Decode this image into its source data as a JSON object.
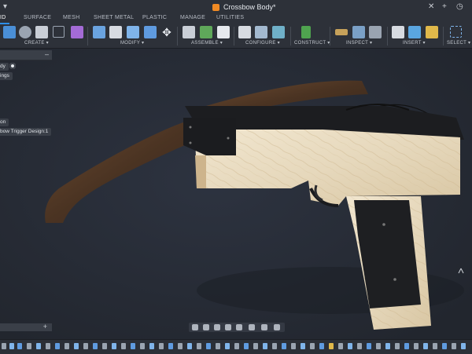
{
  "window": {
    "title": "Crossbow Body*",
    "menu_caret": "▾",
    "ctl_close": "✕",
    "ctl_plus": "+",
    "ctl_clock": "◷"
  },
  "tabs": [
    {
      "label": "ID",
      "active": true
    },
    {
      "label": "SURFACE",
      "active": false
    },
    {
      "label": "MESH",
      "active": false
    },
    {
      "label": "SHEET METAL",
      "active": false
    },
    {
      "label": "PLASTIC",
      "active": false
    },
    {
      "label": "MANAGE",
      "active": false
    },
    {
      "label": "UTILITIES",
      "active": false
    }
  ],
  "ribbon": {
    "groups": [
      {
        "label": "CREATE ▾"
      },
      {
        "label": "MODIFY ▾"
      },
      {
        "label": "ASSEMBLE ▾"
      },
      {
        "label": "CONFIGURE ▾"
      },
      {
        "label": "CONSTRUCT ▾"
      },
      {
        "label": "INSPECT ▾"
      },
      {
        "label": "INSERT ▾"
      },
      {
        "label": "SELECT ▾"
      }
    ]
  },
  "browser": {
    "collapse_icon": "–",
    "items": [
      {
        "label": "dy"
      },
      {
        "label": "ings"
      },
      {
        "label": "on"
      },
      {
        "label": "bow Trigger Design:1"
      }
    ]
  },
  "comments": {
    "add_icon": "+"
  },
  "colors": {
    "accent": "#2e8ee8",
    "wood_light": "#e8dcc4",
    "wood_dark": "#4a3322",
    "metal": "#1c1d20",
    "viewport": "#262b35"
  },
  "icons": {
    "nav": [
      "orbit-icon",
      "pan-icon",
      "look-at-icon",
      "zoom-icon",
      "fit-icon",
      "display-settings-icon",
      "grid-icon",
      "viewports-icon"
    ],
    "timeline": [
      "play-start-icon",
      "step-back-icon",
      "play-icon",
      "step-forward-icon",
      "play-end-icon"
    ]
  }
}
